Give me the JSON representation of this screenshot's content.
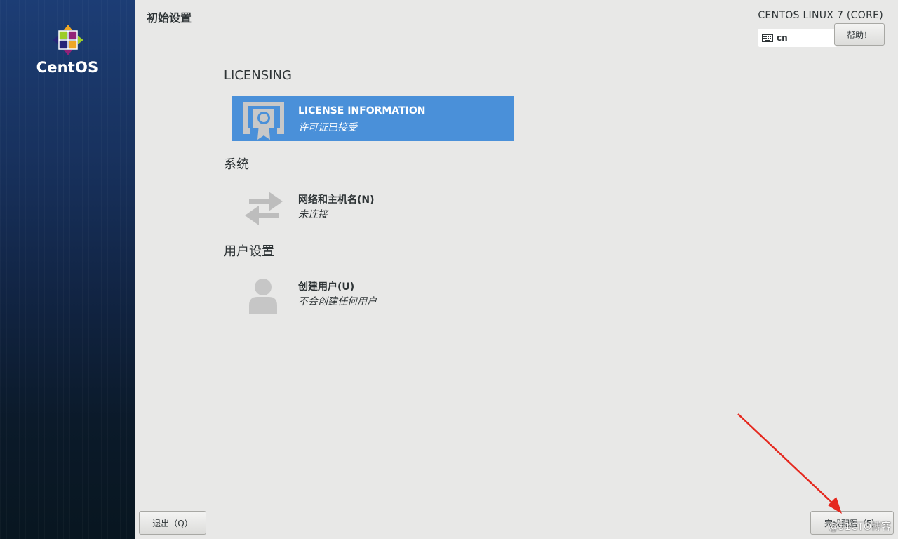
{
  "brand": {
    "logo_text": "CentOS"
  },
  "header": {
    "page_title": "初始设置",
    "product_name": "CENTOS LINUX 7 (CORE)",
    "keyboard_layout": "cn",
    "help_label": "帮助！"
  },
  "sections": [
    {
      "title": "LICENSING",
      "spokes": [
        {
          "title": "LICENSE INFORMATION",
          "status": "许可证已接受",
          "icon": "license-icon",
          "selected": true
        }
      ]
    },
    {
      "title": "系统",
      "spokes": [
        {
          "title": "网络和主机名(N)",
          "status": "未连接",
          "icon": "network-icon",
          "selected": false
        }
      ]
    },
    {
      "title": "用户设置",
      "spokes": [
        {
          "title": "创建用户(U)",
          "status": "不会创建任何用户",
          "icon": "user-icon",
          "selected": false
        }
      ]
    }
  ],
  "footer": {
    "quit_label": "退出（Q）",
    "finish_label": "完成配置（F）"
  },
  "watermark": "@51CTO博客",
  "colors": {
    "selected": "#4a90d9",
    "background": "#e8e8e7",
    "sidebar": "#1c3d75",
    "arrow": "#e5281e"
  }
}
